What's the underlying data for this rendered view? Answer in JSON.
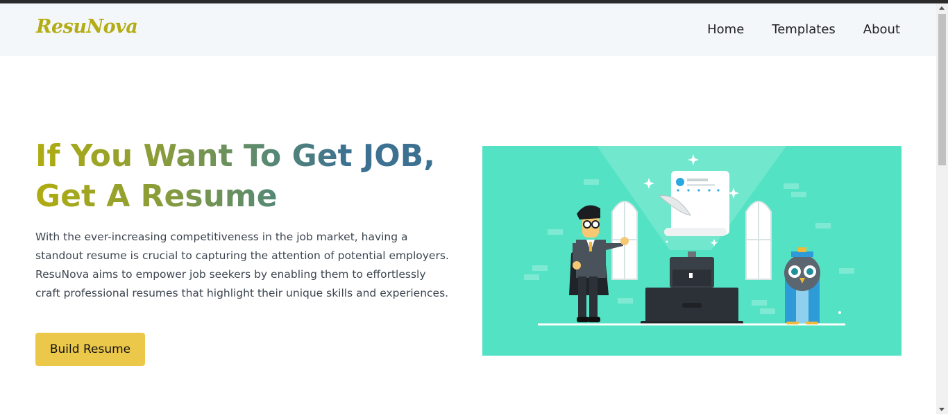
{
  "brand": {
    "name": "ResuNova"
  },
  "nav": {
    "items": [
      {
        "label": "Home"
      },
      {
        "label": "Templates"
      },
      {
        "label": "About"
      }
    ]
  },
  "hero": {
    "title_line1": "If You Want To Get JOB,",
    "title_line2": "Get A Resume",
    "description": "With the ever-increasing competitiveness in the job market, having a standout resume is crucial to capturing the attention of potential employers. ResuNova aims to empower job seekers by enabling them to effortlessly craft professional resumes that highlight their unique skills and experiences.",
    "cta_label": "Build Resume"
  },
  "colors": {
    "brand": "#b3ac14",
    "cta": "#ecc84a",
    "illustration_bg": "#54e2c4",
    "navbar_bg": "#f4f7fa"
  }
}
